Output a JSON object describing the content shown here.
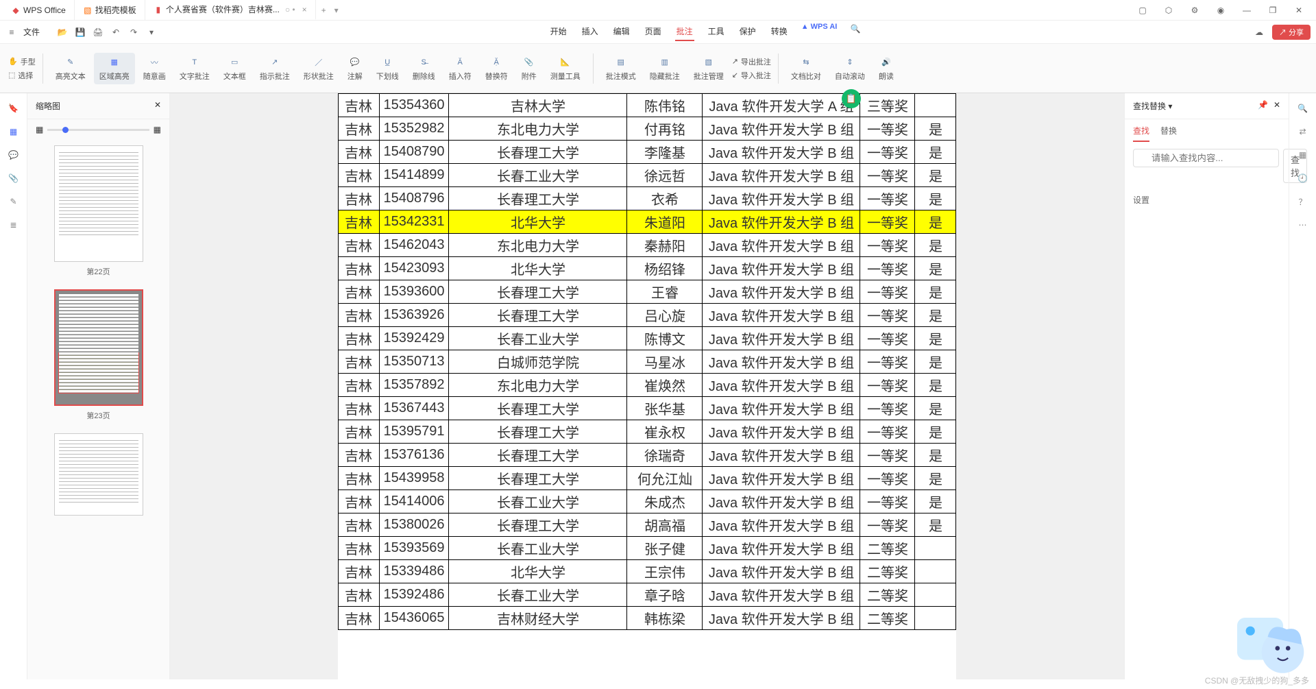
{
  "title_tabs": [
    {
      "label": "WPS Office",
      "icon_color": "#e14c4c"
    },
    {
      "label": "找稻壳模板",
      "icon_color": "#ff6a00"
    },
    {
      "label": "个人赛省赛（软件赛）吉林赛...",
      "icon_color": "#e14c4c",
      "extra": "○ •"
    }
  ],
  "menubar": {
    "file": "文件",
    "items": [
      "开始",
      "插入",
      "编辑",
      "页面",
      "批注",
      "工具",
      "保护",
      "转换"
    ],
    "active": "批注",
    "ai": "WPS AI",
    "share": "分享"
  },
  "toolbar": {
    "hand": "手型",
    "select": "选择",
    "highlight": "高亮文本",
    "area": "区域高亮",
    "freedraw": "随意画",
    "textnote": "文字批注",
    "textbox": "文本框",
    "arrow": "指示批注",
    "shape": "形状批注",
    "note": "注解",
    "underline": "下划线",
    "strike": "删除线",
    "insert": "插入符",
    "replace": "替换符",
    "attach": "附件",
    "measure": "测量工具",
    "mode": "批注模式",
    "hide": "隐藏批注",
    "manage": "批注管理",
    "export": "导出批注",
    "import": "导入批注",
    "compare": "文档比对",
    "autoscroll": "自动滚动",
    "read": "朗读"
  },
  "thumbnails": {
    "title": "缩略图",
    "pages": [
      "第22页",
      "第23页"
    ]
  },
  "find_panel": {
    "title": "查找替换",
    "tab_find": "查找",
    "tab_replace": "替换",
    "placeholder": "请输入查找内容...",
    "btn": "查找",
    "settings": "设置"
  },
  "table": {
    "rows": [
      {
        "c1": "吉林",
        "c2": "15354360",
        "c3": "吉林大学",
        "c4": "陈伟铭",
        "c5": "Java 软件开发大学 A 组",
        "c6": "三等奖",
        "c7": ""
      },
      {
        "c1": "吉林",
        "c2": "15352982",
        "c3": "东北电力大学",
        "c4": "付再铭",
        "c5": "Java 软件开发大学 B 组",
        "c6": "一等奖",
        "c7": "是"
      },
      {
        "c1": "吉林",
        "c2": "15408790",
        "c3": "长春理工大学",
        "c4": "李隆基",
        "c5": "Java 软件开发大学 B 组",
        "c6": "一等奖",
        "c7": "是"
      },
      {
        "c1": "吉林",
        "c2": "15414899",
        "c3": "长春工业大学",
        "c4": "徐远哲",
        "c5": "Java 软件开发大学 B 组",
        "c6": "一等奖",
        "c7": "是"
      },
      {
        "c1": "吉林",
        "c2": "15408796",
        "c3": "长春理工大学",
        "c4": "衣希",
        "c5": "Java 软件开发大学 B 组",
        "c6": "一等奖",
        "c7": "是"
      },
      {
        "c1": "吉林",
        "c2": "15342331",
        "c3": "北华大学",
        "c4": "朱道阳",
        "c5": "Java 软件开发大学 B 组",
        "c6": "一等奖",
        "c7": "是",
        "hl": true
      },
      {
        "c1": "吉林",
        "c2": "15462043",
        "c3": "东北电力大学",
        "c4": "秦赫阳",
        "c5": "Java 软件开发大学 B 组",
        "c6": "一等奖",
        "c7": "是"
      },
      {
        "c1": "吉林",
        "c2": "15423093",
        "c3": "北华大学",
        "c4": "杨绍锋",
        "c5": "Java 软件开发大学 B 组",
        "c6": "一等奖",
        "c7": "是"
      },
      {
        "c1": "吉林",
        "c2": "15393600",
        "c3": "长春理工大学",
        "c4": "王睿",
        "c5": "Java 软件开发大学 B 组",
        "c6": "一等奖",
        "c7": "是"
      },
      {
        "c1": "吉林",
        "c2": "15363926",
        "c3": "长春理工大学",
        "c4": "吕心旋",
        "c5": "Java 软件开发大学 B 组",
        "c6": "一等奖",
        "c7": "是"
      },
      {
        "c1": "吉林",
        "c2": "15392429",
        "c3": "长春工业大学",
        "c4": "陈博文",
        "c5": "Java 软件开发大学 B 组",
        "c6": "一等奖",
        "c7": "是"
      },
      {
        "c1": "吉林",
        "c2": "15350713",
        "c3": "白城师范学院",
        "c4": "马星冰",
        "c5": "Java 软件开发大学 B 组",
        "c6": "一等奖",
        "c7": "是"
      },
      {
        "c1": "吉林",
        "c2": "15357892",
        "c3": "东北电力大学",
        "c4": "崔焕然",
        "c5": "Java 软件开发大学 B 组",
        "c6": "一等奖",
        "c7": "是"
      },
      {
        "c1": "吉林",
        "c2": "15367443",
        "c3": "长春理工大学",
        "c4": "张华基",
        "c5": "Java 软件开发大学 B 组",
        "c6": "一等奖",
        "c7": "是"
      },
      {
        "c1": "吉林",
        "c2": "15395791",
        "c3": "长春理工大学",
        "c4": "崔永权",
        "c5": "Java 软件开发大学 B 组",
        "c6": "一等奖",
        "c7": "是"
      },
      {
        "c1": "吉林",
        "c2": "15376136",
        "c3": "长春理工大学",
        "c4": "徐瑞奇",
        "c5": "Java 软件开发大学 B 组",
        "c6": "一等奖",
        "c7": "是"
      },
      {
        "c1": "吉林",
        "c2": "15439958",
        "c3": "长春理工大学",
        "c4": "何允江灿",
        "c5": "Java 软件开发大学 B 组",
        "c6": "一等奖",
        "c7": "是"
      },
      {
        "c1": "吉林",
        "c2": "15414006",
        "c3": "长春工业大学",
        "c4": "朱成杰",
        "c5": "Java 软件开发大学 B 组",
        "c6": "一等奖",
        "c7": "是"
      },
      {
        "c1": "吉林",
        "c2": "15380026",
        "c3": "长春理工大学",
        "c4": "胡高福",
        "c5": "Java 软件开发大学 B 组",
        "c6": "一等奖",
        "c7": "是"
      },
      {
        "c1": "吉林",
        "c2": "15393569",
        "c3": "长春工业大学",
        "c4": "张子健",
        "c5": "Java 软件开发大学 B 组",
        "c6": "二等奖",
        "c7": ""
      },
      {
        "c1": "吉林",
        "c2": "15339486",
        "c3": "北华大学",
        "c4": "王宗伟",
        "c5": "Java 软件开发大学 B 组",
        "c6": "二等奖",
        "c7": ""
      },
      {
        "c1": "吉林",
        "c2": "15392486",
        "c3": "长春工业大学",
        "c4": "章子晗",
        "c5": "Java 软件开发大学 B 组",
        "c6": "二等奖",
        "c7": ""
      },
      {
        "c1": "吉林",
        "c2": "15436065",
        "c3": "吉林财经大学",
        "c4": "韩栋梁",
        "c5": "Java 软件开发大学 B 组",
        "c6": "二等奖",
        "c7": ""
      }
    ]
  },
  "watermark": "CSDN @无敌拽少的狗_多多"
}
